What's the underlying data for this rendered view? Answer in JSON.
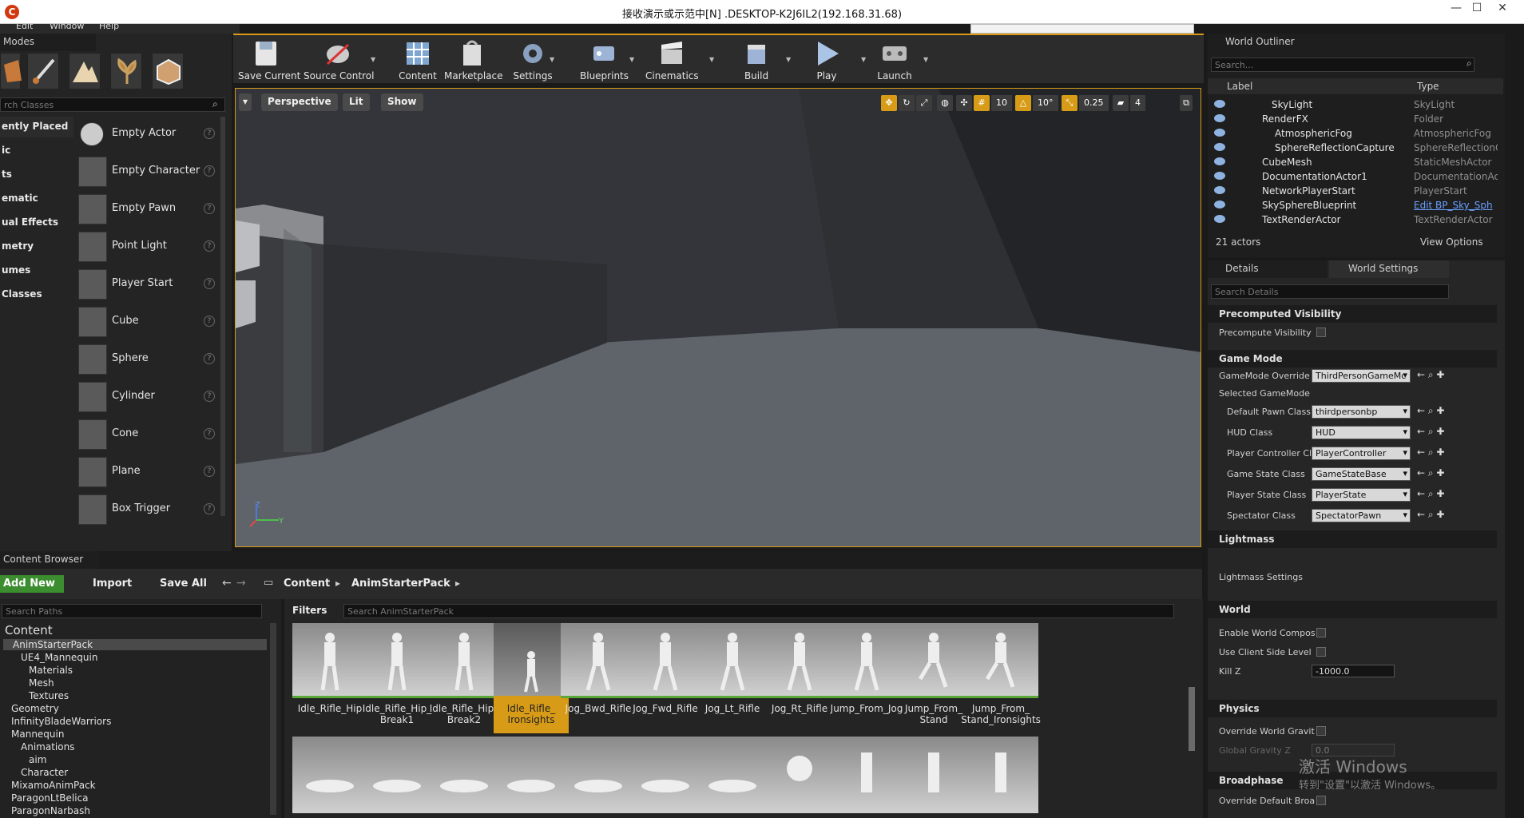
{
  "window": {
    "title": "接收演示或示范中[N] .DESKTOP-K2J6IL2(192.168.31.68)",
    "minimize": "—",
    "maximize": "☐",
    "close": "✕"
  },
  "menu": {
    "items": [
      "Edit",
      "Window",
      "Help"
    ]
  },
  "modes": {
    "tab": "Modes",
    "search_placeholder": "rch Classes",
    "categories": [
      "ently Placed",
      "ic",
      "ts",
      "ematic",
      "ual Effects",
      "metry",
      "umes",
      "Classes"
    ],
    "items": [
      "Empty Actor",
      "Empty Character",
      "Empty Pawn",
      "Point Light",
      "Player Start",
      "Cube",
      "Sphere",
      "Cylinder",
      "Cone",
      "Plane",
      "Box Trigger"
    ],
    "help": "?"
  },
  "toolbar": {
    "buttons": [
      "Save Current",
      "Source Control",
      "Content",
      "Marketplace",
      "Settings",
      "Blueprints",
      "Cinematics",
      "Build",
      "Play",
      "Launch"
    ]
  },
  "viewport": {
    "view_menu": "▾",
    "perspective": "Perspective",
    "lit": "Lit",
    "show": "Show",
    "grid_snap": "10",
    "rot_snap": "10°",
    "scale_snap": "0.25",
    "cam_speed": "4",
    "axis_z": "Z",
    "axis_y": "Y"
  },
  "outliner": {
    "tab": "World Outliner",
    "search_placeholder": "Search...",
    "col_label": "Label",
    "col_type": "Type",
    "rows": [
      {
        "name": "SkyLight",
        "type": "SkyLight"
      },
      {
        "name": "RenderFX",
        "type": "Folder"
      },
      {
        "name": "AtmosphericFog",
        "type": "AtmosphericFog"
      },
      {
        "name": "SphereReflectionCapture",
        "type": "SphereReflectionC"
      },
      {
        "name": "CubeMesh",
        "type": "StaticMeshActor"
      },
      {
        "name": "DocumentationActor1",
        "type": "DocumentationAc"
      },
      {
        "name": "NetworkPlayerStart",
        "type": "PlayerStart"
      },
      {
        "name": "SkySphereBlueprint",
        "type": "Edit BP_Sky_Sph"
      },
      {
        "name": "TextRenderActor",
        "type": "TextRenderActor"
      }
    ],
    "actor_count": "21 actors",
    "view_options": "View Options"
  },
  "details": {
    "tab_details": "Details",
    "tab_world_settings": "World Settings",
    "search_placeholder": "Search Details",
    "precomputed": {
      "header": "Precomputed Visibility",
      "precompute": "Precompute Visibility"
    },
    "game_mode": {
      "header": "Game Mode",
      "override_label": "GameMode Override",
      "override_value": "ThirdPersonGameMc",
      "selected": "Selected GameMode",
      "rows": [
        {
          "label": "Default Pawn Class",
          "value": "thirdpersonbp"
        },
        {
          "label": "HUD Class",
          "value": "HUD"
        },
        {
          "label": "Player Controller Cla",
          "value": "PlayerController"
        },
        {
          "label": "Game State Class",
          "value": "GameStateBase"
        },
        {
          "label": "Player State Class",
          "value": "PlayerState"
        },
        {
          "label": "Spectator Class",
          "value": "SpectatorPawn"
        }
      ]
    },
    "lightmass": {
      "header": "Lightmass",
      "settings": "Lightmass Settings"
    },
    "world": {
      "header": "World",
      "enable": "Enable World Composi",
      "client": "Use Client Side Level :",
      "killz_label": "Kill Z",
      "killz_value": "-1000.0"
    },
    "physics": {
      "header": "Physics",
      "override": "Override World Gravity",
      "gravity_label": "Global Gravity Z",
      "gravity_value": "0.0"
    },
    "broadphase": {
      "header": "Broadphase",
      "override": "Override Default Broac"
    }
  },
  "content_browser": {
    "tab": "Content Browser",
    "add_new": "Add New",
    "import": "Import",
    "save_all": "Save All",
    "path": [
      "Content",
      "AnimStarterPack"
    ],
    "search_paths": "Search Paths",
    "filters": "Filters",
    "search_assets": "Search AnimStarterPack",
    "tree": [
      "Content",
      "AnimStarterPack",
      "UE4_Mannequin",
      "Materials",
      "Mesh",
      "Textures",
      "Geometry",
      "InfinityBladeWarriors",
      "Mannequin",
      "Animations",
      "aim",
      "Character",
      "MixamoAnimPack",
      "ParagonLtBelica",
      "ParagonNarbash"
    ],
    "assets": [
      "Idle_Rifle_Hip",
      "Idle_Rifle_Hip_ Break1",
      "Idle_Rifle_Hip_ Break2",
      "Idle_Rifle_ Ironsights",
      "Jog_Bwd_Rifle",
      "Jog_Fwd_Rifle",
      "Jog_Lt_Rifle",
      "Jog_Rt_Rifle",
      "Jump_From_Jog",
      "Jump_From_ Stand",
      "Jump_From_ Stand_Ironsights"
    ]
  },
  "watermark": {
    "line1": "激活 Windows",
    "line2": "转到\"设置\"以激活 Windows。"
  },
  "colors": {
    "accent": "#d79b17",
    "add_new": "#3c8d2f",
    "panel": "#242424"
  }
}
